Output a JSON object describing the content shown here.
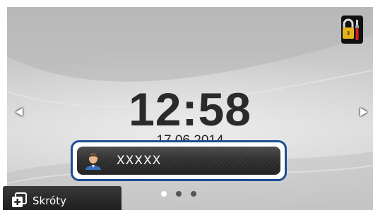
{
  "clock": {
    "time": "12:58",
    "date": "17.06.2014"
  },
  "user": {
    "name": "XXXXX"
  },
  "shortcuts": {
    "label": "Skróty"
  },
  "pagination": {
    "pages": 3,
    "active_index": 0
  },
  "toolbar": {
    "tools_icon": "lock-tools-icon"
  },
  "colors": {
    "selection_border": "#1b4d94",
    "user_bar": "#2e2e2e",
    "clock_text": "#2a2a2a",
    "lock_body": "#e2b31b",
    "tool_red": "#d32020"
  }
}
